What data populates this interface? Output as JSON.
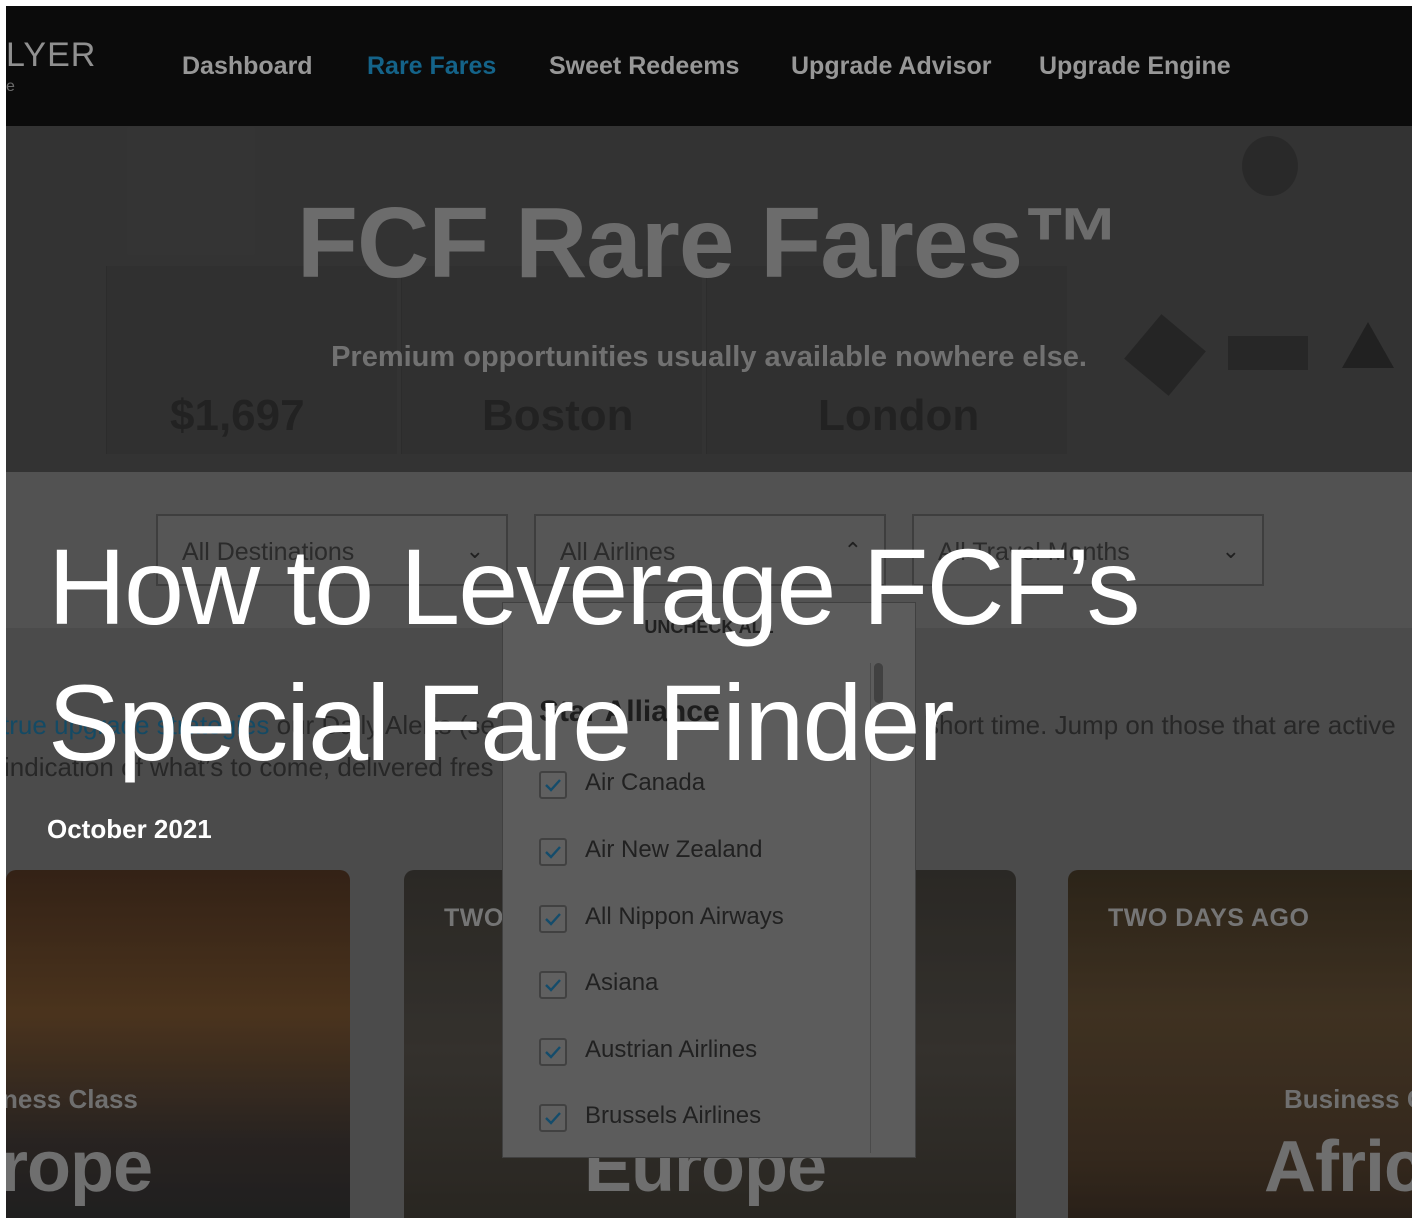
{
  "site": {
    "logo_text": "LYER",
    "logo_sub": "e"
  },
  "nav": {
    "items": [
      {
        "label": "Dashboard",
        "active": false
      },
      {
        "label": "Rare Fares",
        "active": true
      },
      {
        "label": "Sweet Redeems",
        "active": false
      },
      {
        "label": "Upgrade Advisor",
        "active": false
      },
      {
        "label": "Upgrade Engine",
        "active": false
      }
    ]
  },
  "hero": {
    "title": "FCF Rare Fares™",
    "subtitle": "Premium opportunities usually available nowhere else.",
    "ghost": {
      "price": "$1,697",
      "origin": "Boston",
      "destination": "London"
    }
  },
  "filters": {
    "destinations": "All Destinations",
    "airlines": "All Airlines",
    "months": "All Travel Months"
  },
  "intro": {
    "line1_link": "true upgrade strategies",
    "line1_mid": "our Daily Alerts (se",
    "line1_end": "short time. Jump on those that are active",
    "line2": "indication of what’s to come, delivered fres"
  },
  "dropdown": {
    "uncheck_all": "UNCHECK ALL",
    "group": "Star Alliance",
    "airlines": [
      {
        "label": "Air Canada",
        "checked": true
      },
      {
        "label": "Air New Zealand",
        "checked": true
      },
      {
        "label": "All Nippon Airways",
        "checked": true
      },
      {
        "label": "Asiana",
        "checked": true
      },
      {
        "label": "Austrian Airlines",
        "checked": true
      },
      {
        "label": "Brussels Airlines",
        "checked": true
      }
    ]
  },
  "cards": [
    {
      "tag": "",
      "class": "ness Class",
      "region": "rope"
    },
    {
      "tag": "TWO",
      "class": "",
      "region": "Europe"
    },
    {
      "tag": "TWO DAYS AGO",
      "class": "Business C",
      "region": "Afric"
    }
  ],
  "article": {
    "title": "How to Leverage FCF’s Special Fare Finder",
    "date": "October 2021"
  },
  "colors": {
    "accent": "#1d8fc4",
    "overlay_text": "#ffffff"
  }
}
